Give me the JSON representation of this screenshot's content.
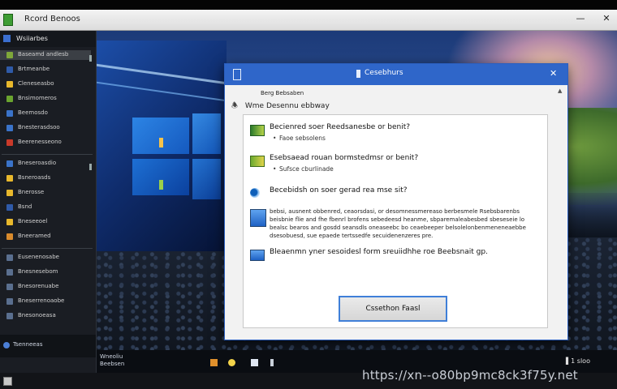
{
  "window": {
    "title": "Rcord Benoos",
    "minimize_glyph": "—",
    "close_glyph": "✕"
  },
  "sidebar": {
    "header_label": "Wsiiarbes",
    "items": [
      {
        "label": "Baseamd andlesb",
        "color": "#7fa83a",
        "selected": true
      },
      {
        "label": "Brtmeanbe",
        "color": "#2f5aa8"
      },
      {
        "label": "Cleneseasbo",
        "color": "#e8b82c"
      },
      {
        "label": "Bnsimomeros",
        "color": "#6aa42f"
      },
      {
        "label": "Beemosdo",
        "color": "#3a73c9"
      },
      {
        "label": "Bnesterasdsoo",
        "color": "#3a73c9"
      },
      {
        "label": "Beerenesseono",
        "color": "#c93a2a"
      },
      {
        "label": "Bneseroasdio",
        "color": "#3a73c9"
      },
      {
        "label": "Bsneroasds",
        "color": "#e8b82c"
      },
      {
        "label": "Bnerosse",
        "color": "#e8b82c"
      },
      {
        "label": "Bsnd",
        "color": "#2f5aa8"
      },
      {
        "label": "Bneseeoel",
        "color": "#e8b82c"
      },
      {
        "label": "Bneeramed",
        "color": "#d88a2c"
      },
      {
        "label": "Eusenenosabe",
        "color": "#5a6f8f"
      },
      {
        "label": "Bnesnesebom",
        "color": "#5a6f8f"
      },
      {
        "label": "Bnesorenuabe",
        "color": "#5a6f8f"
      },
      {
        "label": "Bneserrenoaobe",
        "color": "#5a6f8f"
      },
      {
        "label": "Bnesonoeasa",
        "color": "#5a6f8f"
      }
    ],
    "footer_label": "Tsenneeas"
  },
  "dialog": {
    "title": "Cesebhurs",
    "close_glyph": "✕",
    "breadcrumb": "Berg Bebsaben",
    "heading": "Wme Desennu ebbway",
    "options": [
      {
        "title": "Becienred soer Reedsanesbe or benit?",
        "sub": "Faoe sebsolens",
        "icon": "green-app-icon"
      },
      {
        "title": "Esebsaead rouan bormstedmsr or benit?",
        "sub": "Sufsce cburlinade",
        "icon": "green-app-icon"
      },
      {
        "title": "Becebidsh on soer gerad rea mse sit?",
        "icon": "disc-icon"
      },
      {
        "desc": "bebsi, ausnent obbenred, ceaorsdasi, or desomnessmereaso berbesmele Rsebsbarenbs beisbnie flie and fhe fbenrl brofens sebedeesd heanme, sbparemaleabesbed sbeseseie lo bealsc bearos and gosdd seansdls oneaseebc bo ceaebeeper belsolelonbenmeneneaebbe dsesobuesd, sue epaede tertssedfe secuidenenzeres pre.",
        "icon": "monitor-icon"
      },
      {
        "title": "Bleaenmn yner sesoidesl form sreuiidhhe roe Beebsnait gp.",
        "icon": "monitor-icon"
      }
    ],
    "primary_button": "Cssethon Faasl"
  },
  "taskbar": {
    "label_line1": "Wneoliu",
    "label_line2": "Beebsen",
    "clock": "▌1 sloo"
  },
  "watermark": "https://xn--o80bp9mc8ck3f75y.net"
}
